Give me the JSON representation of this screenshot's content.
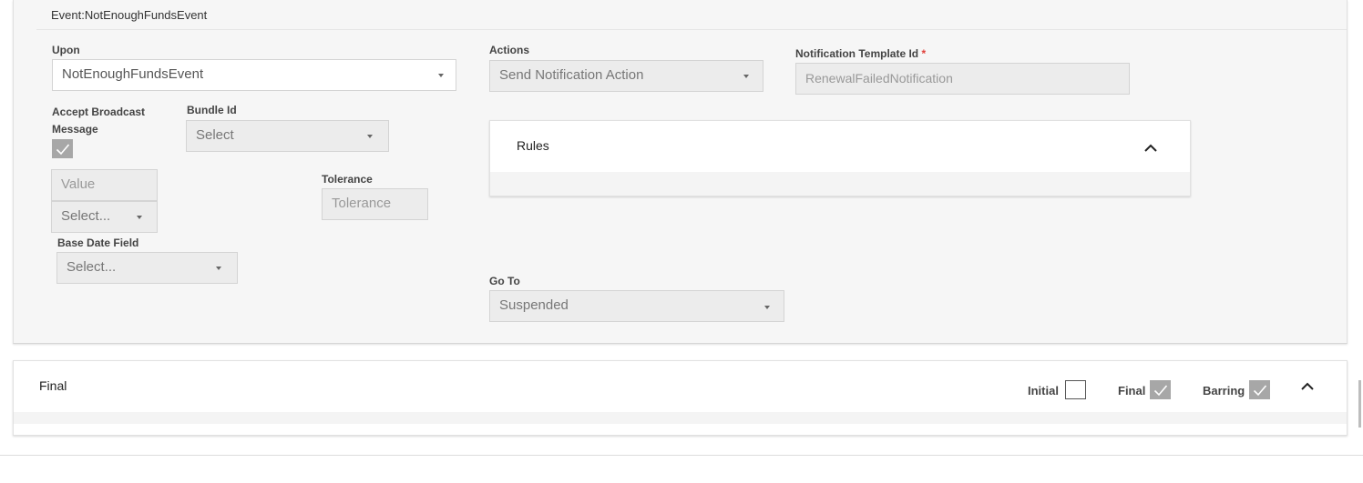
{
  "event": {
    "title": "Event:NotEnoughFundsEvent",
    "upon": {
      "label": "Upon",
      "value": "NotEnoughFundsEvent"
    },
    "accept_broadcast": {
      "label_line1": "Accept Broadcast",
      "label_line2": "Message",
      "checked": true
    },
    "bundle_id": {
      "label": "Bundle Id",
      "placeholder": "Select"
    },
    "value_field": {
      "placeholder": "Value"
    },
    "value_unit_select": {
      "placeholder": "Select..."
    },
    "tolerance": {
      "label": "Tolerance",
      "placeholder": "Tolerance"
    },
    "base_date_field": {
      "label": "Base Date Field",
      "placeholder": "Select..."
    },
    "actions": {
      "label": "Actions",
      "value": "Send Notification Action"
    },
    "notification_template": {
      "label": "Notification Template Id",
      "required_mark": "*",
      "value": "RenewalFailedNotification"
    },
    "rules": {
      "title": "Rules"
    },
    "go_to": {
      "label": "Go To",
      "value": "Suspended"
    }
  },
  "final_state": {
    "title": "Final",
    "initial": {
      "label": "Initial",
      "checked": false
    },
    "final": {
      "label": "Final",
      "checked": true
    },
    "barring": {
      "label": "Barring",
      "checked": true
    }
  },
  "colors": {
    "panel_bg": "#f6f6f6",
    "field_disabled_bg": "#ececec",
    "checkbox_checked": "#a7a7a7",
    "required": "#e0403a"
  }
}
